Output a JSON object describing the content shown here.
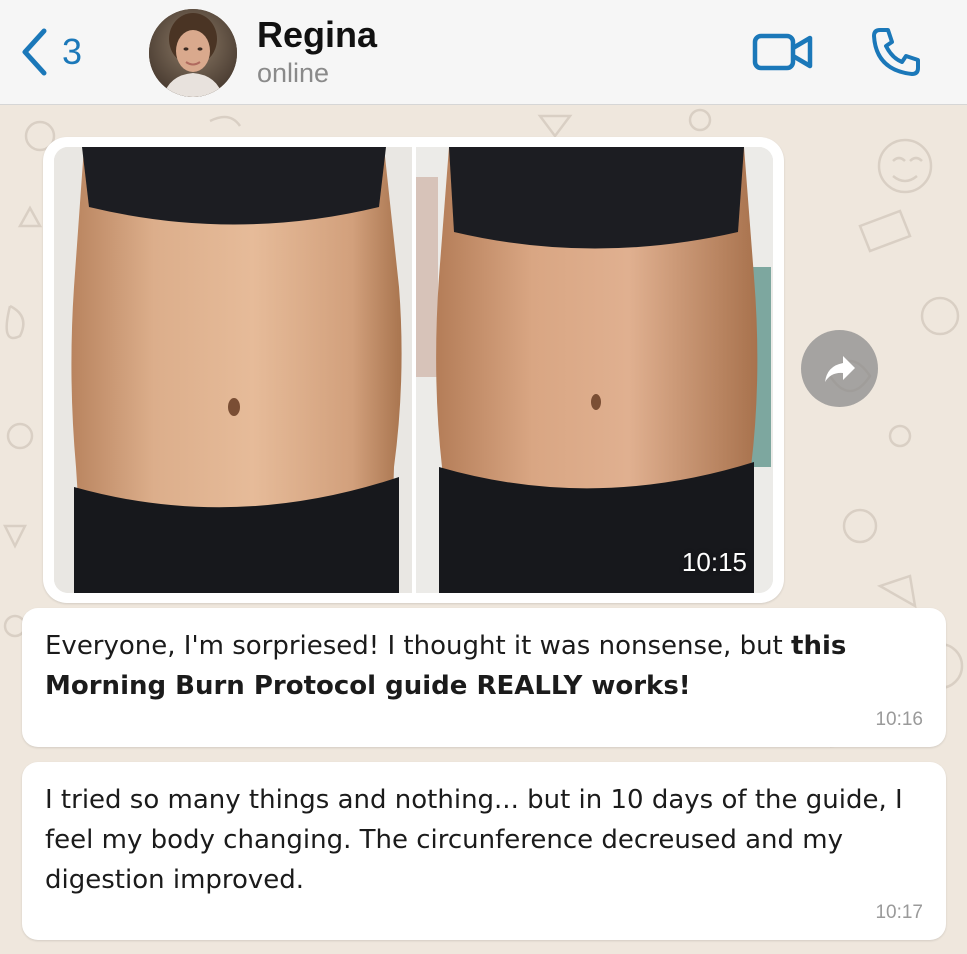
{
  "header": {
    "back_count": "3",
    "contact_name": "Regina",
    "contact_status": "online",
    "icons": [
      "back-chevron-icon",
      "video-call-icon",
      "phone-call-icon"
    ]
  },
  "messages": [
    {
      "type": "image",
      "time": "10:15",
      "description_icon": "forward-icon"
    },
    {
      "type": "text",
      "text_plain": "Everyone, I'm sorpriesed! I thought it was nonsense, but ",
      "text_bold": "this Morning Burn Protocol guide REALLY works!",
      "time": "10:16"
    },
    {
      "type": "text",
      "text_plain": "I tried so many things and nothing... but in 10 days of the guide, I feel my body changing. The circunference decreused and my digestion improved.",
      "time": "10:17"
    }
  ],
  "colors": {
    "accent": "#1b78b9",
    "chat_background": "#efe7dd",
    "bubble": "#ffffff",
    "header": "#f6f6f6"
  }
}
